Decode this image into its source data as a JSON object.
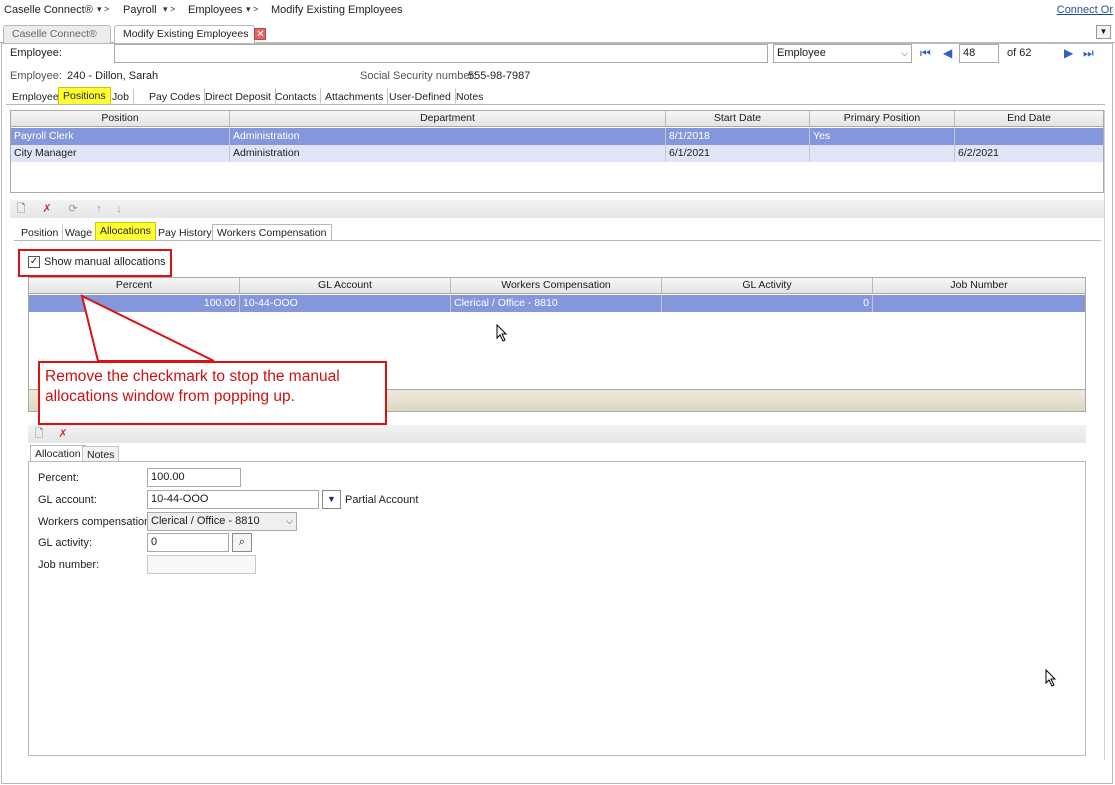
{
  "breadcrumb": {
    "app": "Caselle Connect®",
    "items": [
      "Payroll",
      "Employees",
      "Modify Existing Employees"
    ],
    "connect_link": "Connect Or"
  },
  "doc_tabs": [
    {
      "label": "Caselle Connect®",
      "active": false
    },
    {
      "label": "Modify Existing Employees",
      "active": true
    }
  ],
  "employee_bar": {
    "label": "Employee:",
    "value": "",
    "lookup_select": "Employee",
    "record_number": "48",
    "record_total": "of 62"
  },
  "employee_info": {
    "employee_label": "Employee:",
    "employee_value": "240 - Dillon, Sarah",
    "ssn_label": "Social Security number:",
    "ssn_value": "555-98-7987"
  },
  "main_tabs": [
    "Employee",
    "Positions",
    "Job",
    "Pay Codes",
    "Direct Deposit",
    "Contacts",
    "Attachments",
    "User-Defined",
    "Notes"
  ],
  "positions_grid": {
    "columns": [
      "Position",
      "Department",
      "Start Date",
      "Primary Position",
      "End Date"
    ],
    "rows": [
      [
        "Payroll Clerk",
        "Administration",
        "8/1/2018",
        "Yes",
        ""
      ],
      [
        "City Manager",
        "Administration",
        "6/1/2021",
        "",
        "6/2/2021"
      ]
    ]
  },
  "sub_tabs": [
    "Position",
    "Wage",
    "Allocations",
    "Pay History",
    "Workers Compensation"
  ],
  "show_manual_allocations": {
    "label": "Show manual allocations",
    "checked": true
  },
  "allocations_grid": {
    "columns": [
      "Percent",
      "GL Account",
      "Workers Compensation",
      "GL Activity",
      "Job Number"
    ],
    "rows": [
      [
        "100.00",
        "10-44-OOO",
        "Clerical / Office - 8810",
        "0",
        ""
      ]
    ]
  },
  "annotation": "Remove the checkmark to stop the manual allocations window from popping up.",
  "detail_tabs": [
    "Allocation",
    "Notes"
  ],
  "form": {
    "percent_label": "Percent:",
    "percent_value": "100.00",
    "gl_account_label": "GL account:",
    "gl_account_value": "10-44-OOO",
    "partial_account_label": "Partial Account",
    "workers_comp_label": "Workers compensation:",
    "workers_comp_value": "Clerical / Office - 8810",
    "gl_activity_label": "GL activity:",
    "gl_activity_value": "0",
    "job_number_label": "Job number:",
    "job_number_value": ""
  },
  "colors": {
    "selected_row": "#8497dc",
    "highlight": "#ffff33",
    "annotation": "#e01010"
  }
}
